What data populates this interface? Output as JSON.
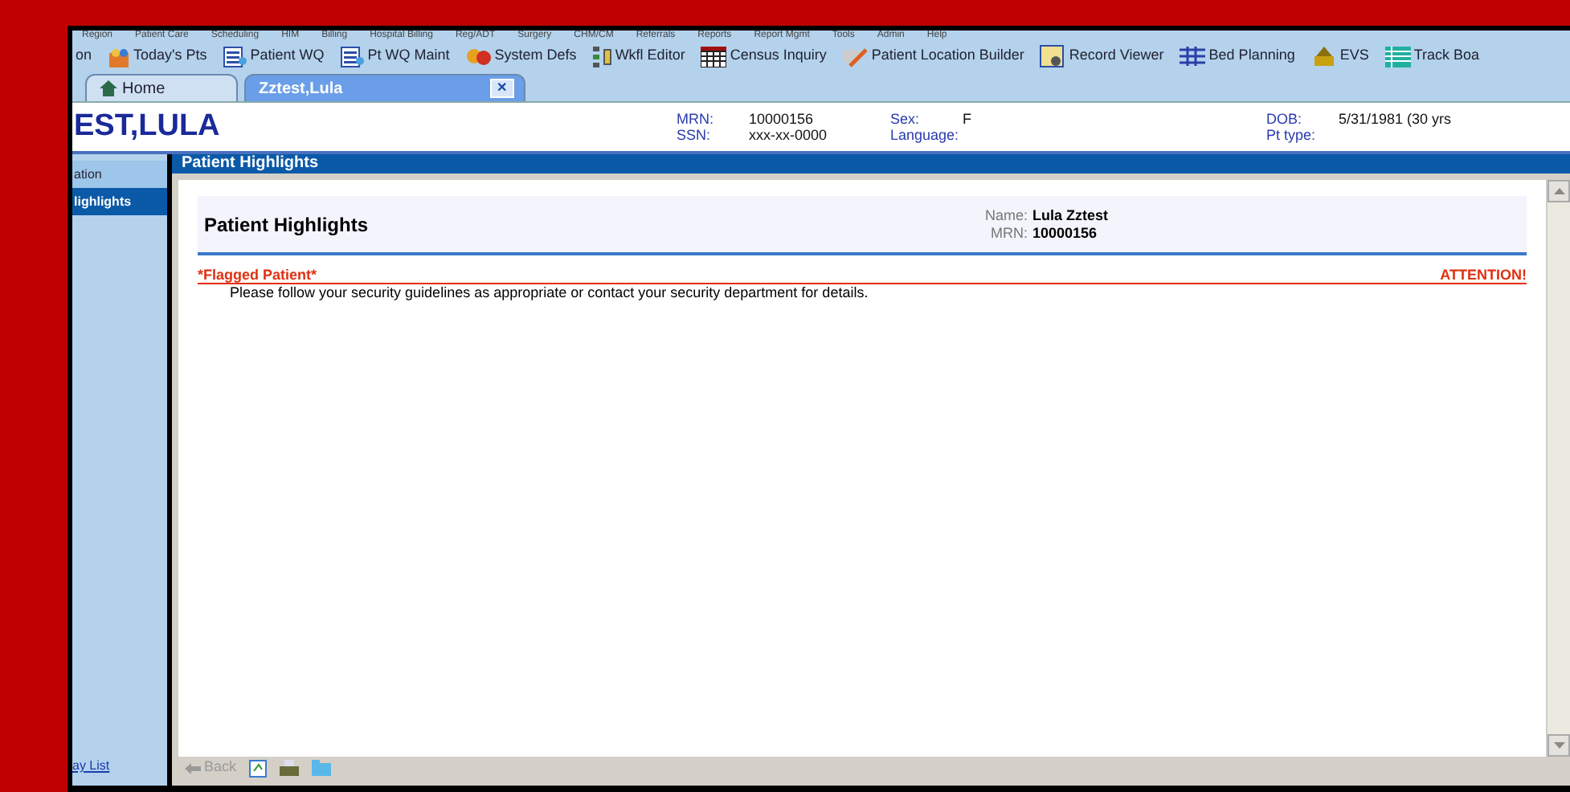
{
  "menu_bar": [
    "Region",
    "Patient Care",
    "Scheduling",
    "HIM",
    "Billing",
    "Hospital Billing",
    "Reg/ADT",
    "Surgery",
    "CHM/CM",
    "Referrals",
    "Reports",
    "Report Mgmt",
    "Tools",
    "Admin",
    "Help"
  ],
  "toolbar": [
    "on",
    "Today's Pts",
    "Patient WQ",
    "Pt WQ Maint",
    "System Defs",
    "Wkfl Editor",
    "Census Inquiry",
    "Patient Location Builder",
    "Record Viewer",
    "Bed Planning",
    "EVS",
    "Track Boa"
  ],
  "tabs": [
    {
      "label": "Home",
      "selected": false
    },
    {
      "label": "Zztest,Lula",
      "selected": true,
      "close": "✕"
    }
  ],
  "patient_header": {
    "name": "EST,LULA",
    "fields": [
      {
        "label": "MRN:",
        "value": "10000156"
      },
      {
        "label": "SSN:",
        "value": "xxx-xx-0000"
      },
      {
        "label": "Sex:",
        "value": "F"
      },
      {
        "label": "Language:"
      },
      {
        "label": "DOB:",
        "value": "5/31/1981 (30 yrs"
      },
      {
        "label": "Pt type:"
      }
    ]
  },
  "sidebar": {
    "items": [
      {
        "label": "ation",
        "selected": false
      },
      {
        "label": "lighlights",
        "selected": true
      }
    ],
    "footer_link": "ay List"
  },
  "panel": {
    "title": "Patient Highlights",
    "heading": "Patient Highlights",
    "name_label": "Name:",
    "name_value": "Lula Zztest",
    "mrn_label": "MRN:",
    "mrn_value": "10000156",
    "flag": "*Flagged Patient*",
    "attention": "ATTENTION!",
    "message": "Please follow your security guidelines as appropriate or contact your security department for details."
  },
  "bottom_bar": {
    "back": "Back",
    "back_disabled": true
  }
}
